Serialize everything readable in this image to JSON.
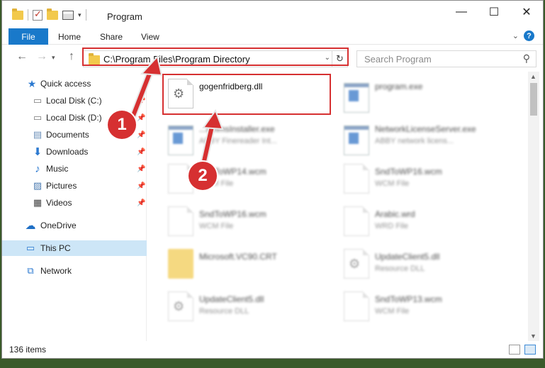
{
  "window": {
    "title": "Program"
  },
  "ribbon": {
    "file": "File",
    "tabs": [
      "Home",
      "Share",
      "View"
    ],
    "help": "?"
  },
  "navbar": {
    "back": "←",
    "forward": "→",
    "up": "↑",
    "address": "C:\\Program Files\\Program Directory",
    "search_placeholder": "Search Program"
  },
  "sidebar": {
    "items": [
      {
        "label": "Quick access",
        "icon": "star-icon"
      },
      {
        "label": "Local Disk (C:)",
        "icon": "drive-icon"
      },
      {
        "label": "Local Disk (D:)",
        "icon": "drive-icon"
      },
      {
        "label": "Documents",
        "icon": "documents-icon"
      },
      {
        "label": "Downloads",
        "icon": "downloads-icon"
      },
      {
        "label": "Music",
        "icon": "music-icon"
      },
      {
        "label": "Pictures",
        "icon": "pictures-icon"
      },
      {
        "label": "Videos",
        "icon": "videos-icon"
      },
      {
        "label": "OneDrive",
        "icon": "cloud-icon"
      },
      {
        "label": "This PC",
        "icon": "computer-icon"
      },
      {
        "label": "Network",
        "icon": "network-icon"
      }
    ]
  },
  "files": [
    {
      "name": "gogenfridberg.dll",
      "sub": "",
      "kind": "gear"
    },
    {
      "name": "program.exe",
      "sub": "",
      "kind": "exe"
    },
    {
      "name": "...ammsInstaller.exe",
      "sub": "ABBY Finereader Int...",
      "kind": "exe"
    },
    {
      "name": "NetworkLicenseServer.exe",
      "sub": "ABBY network licens...",
      "kind": "exe"
    },
    {
      "name": "SndToWP14.wcm",
      "sub": "WCM File",
      "kind": "doc"
    },
    {
      "name": "SndToWP16.wcm",
      "sub": "WCM File",
      "kind": "doc"
    },
    {
      "name": "SndToWP16.wcm",
      "sub": "WCM File",
      "kind": "doc"
    },
    {
      "name": "Arabic.wrd",
      "sub": "WRD File",
      "kind": "doc"
    },
    {
      "name": "Microsoft.VC90.CRT",
      "sub": "",
      "kind": "folder"
    },
    {
      "name": "UpdateClient5.dll",
      "sub": "Resource DLL",
      "kind": "gear"
    },
    {
      "name": "UpdateClient5.dll",
      "sub": "Resource DLL",
      "kind": "gear"
    },
    {
      "name": "SndToWP13.wcm",
      "sub": "WCM File",
      "kind": "doc"
    }
  ],
  "status": {
    "count": "136 items"
  },
  "annotations": {
    "step1": "1",
    "step2": "2"
  },
  "colors": {
    "accent": "#1979ca",
    "highlight": "#d63031",
    "selected": "#cde6f7"
  }
}
